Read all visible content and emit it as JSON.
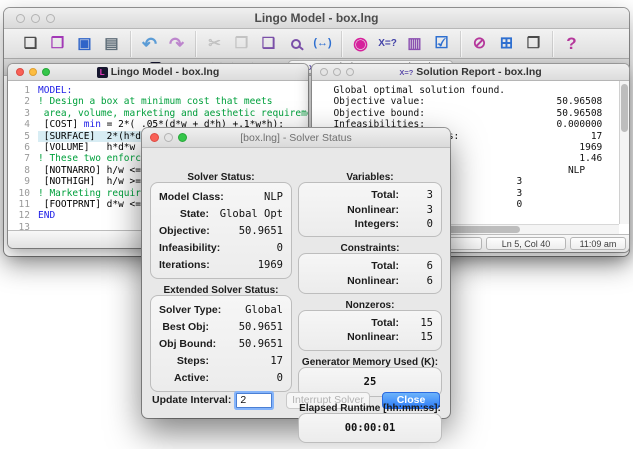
{
  "app": {
    "title": "Lingo Model - box.lng"
  },
  "glyphs": {
    "tab_close": "×",
    "logo_letter": "L",
    "xeq": "X=?"
  },
  "toolbar": {
    "groups": [
      [
        {
          "name": "new-file-button",
          "glyph": "❏",
          "color": "#4b4b4b",
          "size": 15
        },
        {
          "name": "open-file-button",
          "glyph": "❒",
          "color": "#a238b6",
          "size": 15
        },
        {
          "name": "save-button",
          "glyph": "▣",
          "color": "#2f64c8",
          "size": 15
        },
        {
          "name": "print-button",
          "glyph": "▤",
          "color": "#5f6e79",
          "size": 15
        }
      ],
      [
        {
          "name": "undo-button",
          "glyph": "↶",
          "color": "#5b9cd6",
          "size": 18
        },
        {
          "name": "redo-button",
          "glyph": "↷",
          "color": "#bd86cd",
          "size": 18
        }
      ],
      [
        {
          "name": "cut-button",
          "glyph": "✂",
          "color": "#bcbcbc",
          "size": 15,
          "disabled": true
        },
        {
          "name": "copy-button",
          "glyph": "❐",
          "color": "#bcbcbc",
          "size": 15,
          "disabled": true
        },
        {
          "name": "paste-button",
          "glyph": "❑",
          "color": "#7a4fa8",
          "size": 15
        },
        {
          "name": "find-button",
          "glyph": "magnifier",
          "color": "#7a4fa8",
          "size": 15
        },
        {
          "name": "match-paren-button",
          "glyph": "(↔)",
          "color": "#2e6fd0",
          "size": 11
        }
      ],
      [
        {
          "name": "solve-button",
          "glyph": "◉",
          "color": "#d6219c",
          "size": 17
        },
        {
          "name": "solution-button",
          "glyph": "X=?",
          "color": "#4444a8",
          "size": 10
        },
        {
          "name": "chart-button",
          "glyph": "▥",
          "color": "#8a4fb0",
          "size": 15
        },
        {
          "name": "options-button",
          "glyph": "☑",
          "color": "#2e6fd0",
          "size": 16
        }
      ],
      [
        {
          "name": "close-all-windows-button",
          "glyph": "⊘",
          "color": "#b5379b",
          "size": 16
        },
        {
          "name": "tile-windows-button",
          "glyph": "⊞",
          "color": "#2e6fd0",
          "size": 16
        },
        {
          "name": "cascade-windows-button",
          "glyph": "❐",
          "color": "#4b4b4b",
          "size": 15
        }
      ],
      [
        {
          "name": "help-button",
          "glyph": "?",
          "color": "#b5379b",
          "size": 17
        }
      ]
    ]
  },
  "tabs": [
    {
      "label": "Lingo Model - box.lng",
      "icon": "lingo",
      "active": false
    },
    {
      "label": "Solution Report - box.lng",
      "icon": "xeq",
      "active": true
    }
  ],
  "model_window": {
    "title": "Lingo Model - box.lng",
    "lines": [
      {
        "n": "1",
        "hl": false,
        "parts": [
          {
            "t": "MODEL:",
            "c": "kw"
          }
        ]
      },
      {
        "n": "2",
        "hl": false,
        "parts": [
          {
            "t": "! Design a box at minimum cost that meets",
            "c": "cm"
          }
        ]
      },
      {
        "n": "3",
        "hl": false,
        "parts": [
          {
            "t": " area, volume, marketing and aesthetic requirements;",
            "c": "cm"
          }
        ]
      },
      {
        "n": "4",
        "hl": false,
        "parts": [
          {
            "t": " [COST] ",
            "c": "pl"
          },
          {
            "t": "min",
            "c": "kw"
          },
          {
            "t": " = 2*( .05*(d*w + d*h) +.1*w*h);",
            "c": "pl"
          }
        ]
      },
      {
        "n": "5",
        "hl": true,
        "parts": [
          {
            "t": " [SURFACE]  2*(h*d + h*w + d*w) >= 888;",
            "c": "pl"
          }
        ]
      },
      {
        "n": "6",
        "hl": false,
        "parts": [
          {
            "t": " [VOLUME]   h*d*w >= 1",
            "c": "pl"
          }
        ]
      },
      {
        "n": "7",
        "hl": false,
        "parts": [
          {
            "t": "! These two enforce ae",
            "c": "cm"
          }
        ]
      },
      {
        "n": "8",
        "hl": false,
        "parts": [
          {
            "t": " [NOTNARRO] h/w <= .71",
            "c": "pl"
          }
        ]
      },
      {
        "n": "9",
        "hl": false,
        "parts": [
          {
            "t": " [NOTHIGH]  h/w >= .51",
            "c": "pl"
          }
        ]
      },
      {
        "n": "10",
        "hl": false,
        "parts": [
          {
            "t": "! Marketing requires a",
            "c": "cm"
          }
        ]
      },
      {
        "n": "11",
        "hl": false,
        "parts": [
          {
            "t": " [FOOTPRNT] d*w <= 252",
            "c": "pl"
          }
        ]
      },
      {
        "n": "12",
        "hl": false,
        "parts": [
          {
            "t": "END",
            "c": "kw"
          }
        ]
      },
      {
        "n": "13",
        "hl": false,
        "parts": []
      }
    ]
  },
  "report_window": {
    "title": "Solution Report - box.lng",
    "lines": [
      "  Global optimal solution found.",
      "  Objective value:                       50.96508",
      "  Objective bound:                       50.96508",
      "  Infeasibilities:                       0.000000",
      "  Extended solver steps:                       17",
      "                                             1969",
      "                                             1.46",
      "",
      "                                           NLP",
      "",
      "                                  3",
      "                                  3",
      "                                  0"
    ],
    "status_cells": [
      "",
      "",
      "Ln 5, Col 40",
      "11:09 am"
    ]
  },
  "dialog": {
    "title": "[box.lng] - Solver Status",
    "groups": {
      "solver_status": {
        "label": "Solver Status:",
        "rows": [
          [
            "Model Class:",
            "NLP"
          ],
          [
            "State:",
            "Global Opt"
          ],
          [
            "Objective:",
            "50.9651"
          ],
          [
            "Infeasibility:",
            "0"
          ],
          [
            "Iterations:",
            "1969"
          ]
        ]
      },
      "extended": {
        "label": "Extended Solver Status:",
        "rows": [
          [
            "Solver Type:",
            "Global"
          ],
          [
            "Best Obj:",
            "50.9651"
          ],
          [
            "Obj Bound:",
            "50.9651"
          ],
          [
            "Steps:",
            "17"
          ],
          [
            "Active:",
            "0"
          ]
        ]
      },
      "variables": {
        "label": "Variables:",
        "rows": [
          [
            "Total:",
            "3"
          ],
          [
            "Nonlinear:",
            "3"
          ],
          [
            "Integers:",
            "0"
          ]
        ]
      },
      "constraints": {
        "label": "Constraints:",
        "rows": [
          [
            "Total:",
            "6"
          ],
          [
            "Nonlinear:",
            "6"
          ]
        ]
      },
      "nonzeros": {
        "label": "Nonzeros:",
        "rows": [
          [
            "Total:",
            "15"
          ],
          [
            "Nonlinear:",
            "15"
          ]
        ]
      },
      "generator": {
        "label": "Generator Memory Used (K):",
        "value": "25"
      },
      "runtime": {
        "label": "Elapsed Runtime [hh:mm:ss]:",
        "value": "00:00:01"
      }
    },
    "update_interval": {
      "label": "Update Interval:",
      "value": "2"
    },
    "buttons": {
      "interrupt": "Interrupt Solver",
      "close": "Close"
    }
  },
  "colors": {
    "accent_blue": "#2d7cf7",
    "highlight_line": "#d8edf4",
    "keyword": "#1e1ee6",
    "comment": "#00a03c"
  }
}
